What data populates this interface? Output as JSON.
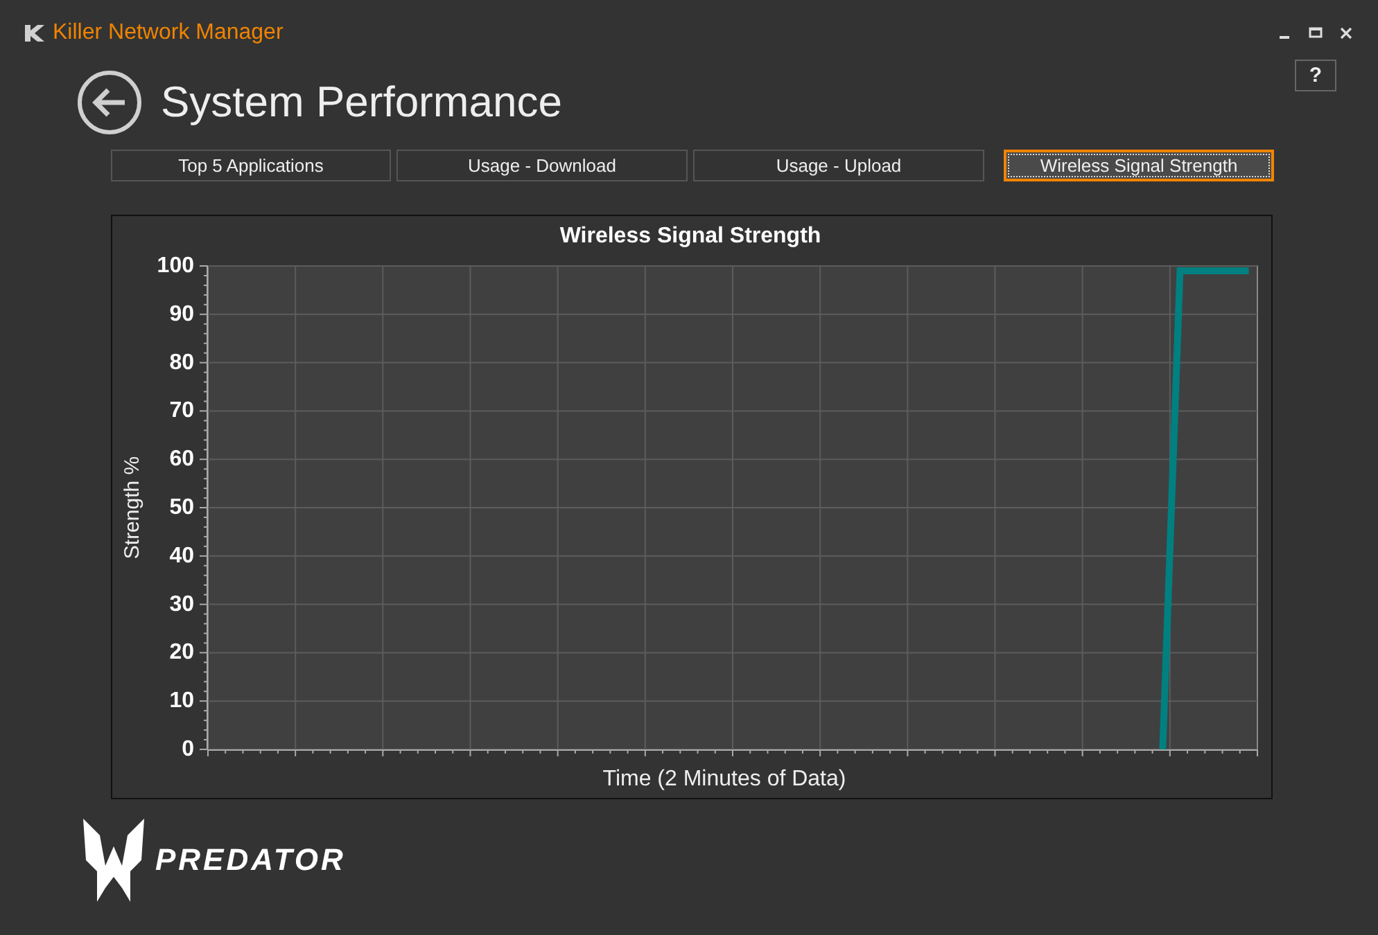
{
  "window": {
    "title": "Killer Network Manager"
  },
  "page": {
    "title": "System Performance",
    "help": "?"
  },
  "tabs": [
    {
      "label": "Top 5 Applications",
      "selected": false
    },
    {
      "label": "Usage - Download",
      "selected": false
    },
    {
      "label": "Usage - Upload",
      "selected": false
    },
    {
      "label": "Wireless Signal Strength",
      "selected": true
    }
  ],
  "chart_data": {
    "type": "line",
    "title": "Wireless Signal Strength",
    "xlabel": "Time (2 Minutes of Data)",
    "ylabel": "Strength %",
    "ylim": [
      0,
      100
    ],
    "grid": true,
    "yticks": [
      0,
      10,
      20,
      30,
      40,
      50,
      60,
      70,
      80,
      90,
      100
    ],
    "categories": [
      null,
      null,
      null,
      null,
      null,
      null,
      null,
      null,
      null,
      null,
      null,
      null,
      null,
      null,
      null,
      null,
      null,
      null,
      null,
      null,
      null,
      null,
      null,
      null,
      null,
      null,
      null,
      null,
      null,
      null,
      null,
      null,
      null,
      null,
      null,
      null,
      null,
      null,
      null,
      null,
      null,
      null,
      null,
      null,
      null,
      null,
      null,
      null,
      null,
      null,
      null,
      null,
      null,
      null,
      null,
      null,
      null,
      null,
      null,
      null,
      null
    ],
    "series": [
      {
        "color": "#008080",
        "values": [
          null,
          null,
          null,
          null,
          null,
          null,
          null,
          null,
          null,
          null,
          null,
          null,
          null,
          null,
          null,
          null,
          null,
          null,
          null,
          null,
          null,
          null,
          null,
          null,
          null,
          null,
          null,
          null,
          null,
          null,
          null,
          null,
          null,
          null,
          null,
          null,
          null,
          null,
          null,
          null,
          null,
          null,
          null,
          null,
          null,
          null,
          null,
          null,
          null,
          null,
          null,
          null,
          null,
          null,
          null,
          0,
          99,
          99,
          99,
          99,
          99
        ]
      }
    ]
  },
  "brand": {
    "name": "PREDATOR"
  }
}
